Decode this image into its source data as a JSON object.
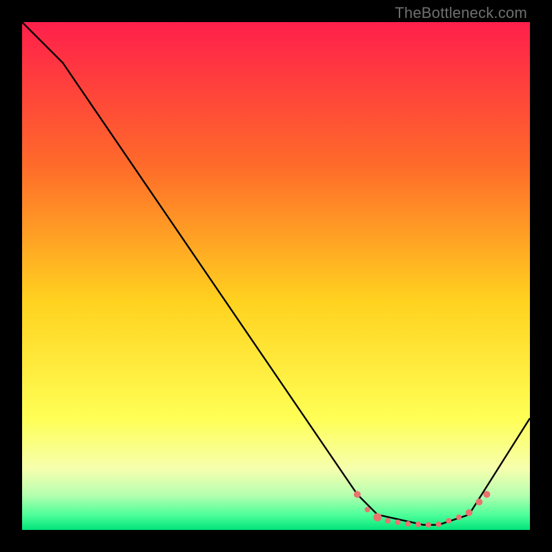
{
  "watermark": "TheBottleneck.com",
  "chart_data": {
    "type": "line",
    "title": "",
    "xlabel": "",
    "ylabel": "",
    "xlim": [
      0,
      100
    ],
    "ylim": [
      0,
      100
    ],
    "background_gradient": {
      "stops": [
        {
          "pos": 0.0,
          "color": "#ff1f4b"
        },
        {
          "pos": 0.28,
          "color": "#ff6a2a"
        },
        {
          "pos": 0.55,
          "color": "#ffd21f"
        },
        {
          "pos": 0.78,
          "color": "#ffff55"
        },
        {
          "pos": 0.88,
          "color": "#f6ffae"
        },
        {
          "pos": 0.93,
          "color": "#b8ffb0"
        },
        {
          "pos": 0.97,
          "color": "#4fff9a"
        },
        {
          "pos": 1.0,
          "color": "#00e47a"
        }
      ]
    },
    "series": [
      {
        "name": "bottleneck-curve",
        "x": [
          0,
          8,
          66,
          70,
          79,
          82,
          88,
          100
        ],
        "y": [
          100,
          92,
          7,
          3,
          1,
          1,
          3,
          22
        ],
        "stroke": "#000000"
      }
    ],
    "markers": {
      "name": "highlighted-points",
      "color": "#e9736f",
      "points": [
        {
          "x": 66,
          "y": 7,
          "r": 5
        },
        {
          "x": 68,
          "y": 4,
          "r": 4
        },
        {
          "x": 70,
          "y": 2.5,
          "r": 6
        },
        {
          "x": 72,
          "y": 1.8,
          "r": 4
        },
        {
          "x": 74,
          "y": 1.5,
          "r": 4
        },
        {
          "x": 76,
          "y": 1.2,
          "r": 4
        },
        {
          "x": 78,
          "y": 1.1,
          "r": 4
        },
        {
          "x": 80,
          "y": 1.0,
          "r": 4
        },
        {
          "x": 82,
          "y": 1.1,
          "r": 4
        },
        {
          "x": 84,
          "y": 1.8,
          "r": 4
        },
        {
          "x": 86,
          "y": 2.5,
          "r": 4
        },
        {
          "x": 88,
          "y": 3.4,
          "r": 5
        },
        {
          "x": 90,
          "y": 5.5,
          "r": 5
        },
        {
          "x": 91.5,
          "y": 7.0,
          "r": 5
        }
      ]
    }
  }
}
